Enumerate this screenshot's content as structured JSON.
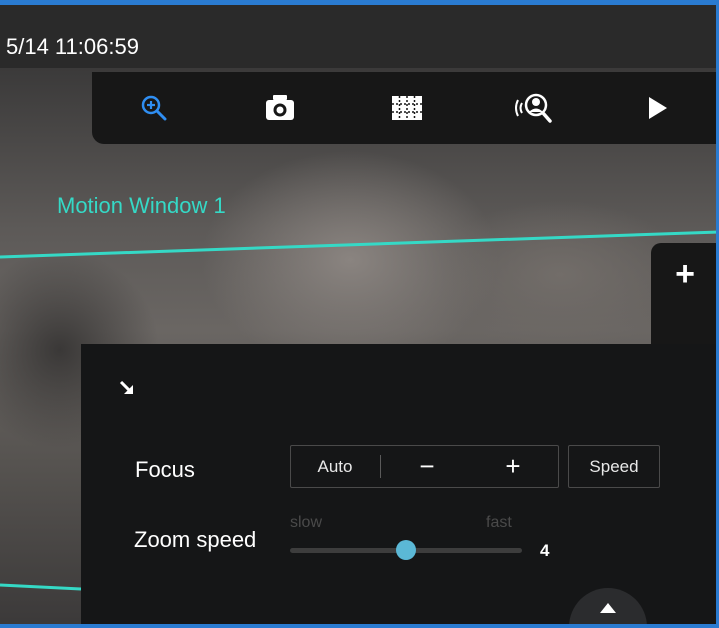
{
  "overlay": {
    "timestamp": "5/14 11:06:59",
    "motion_window_label": "Motion Window 1",
    "plus_label": "+"
  },
  "toolbar": {
    "items": [
      {
        "icon": "zoom-in-icon",
        "color": "#2f8ef2"
      },
      {
        "icon": "camera-icon",
        "color": "#ffffff"
      },
      {
        "icon": "grid-icon",
        "color": "#ffffff"
      },
      {
        "icon": "voice-search-icon",
        "color": "#ffffff"
      },
      {
        "icon": "play-icon",
        "color": "#ffffff"
      }
    ]
  },
  "panel": {
    "focus_label": "Focus",
    "auto_label": "Auto",
    "minus_label": "−",
    "plus_label": "+",
    "speed_label": "Speed",
    "zoom_speed_label": "Zoom speed",
    "slider_min_label": "slow",
    "slider_max_label": "fast",
    "zoom_speed_value": "4",
    "zoom_speed_fraction": 0.5
  },
  "colors": {
    "accent": "#2a7bd1",
    "motion_window": "#35d9c6",
    "slider_thumb": "#5bb8d6"
  }
}
